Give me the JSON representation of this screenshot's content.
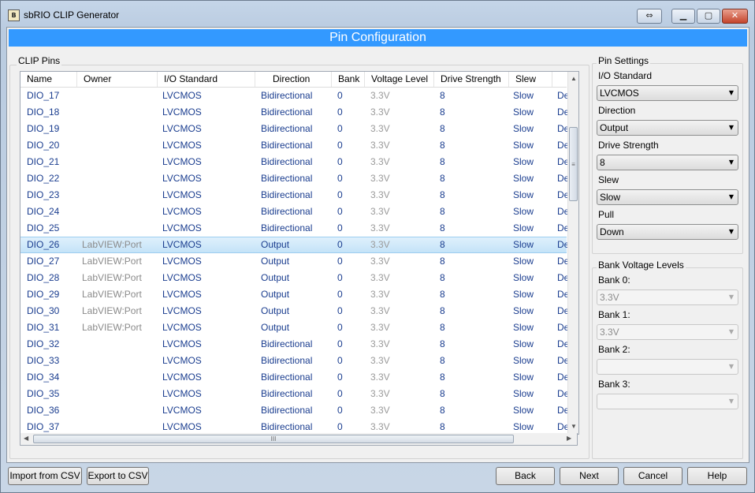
{
  "window": {
    "title": "sbRIO CLIP Generator"
  },
  "banner": {
    "title": "Pin Configuration"
  },
  "clip_pins": {
    "group_label": "CLIP Pins",
    "columns": [
      "Name",
      "Owner",
      "I/O Standard",
      "Direction",
      "Bank",
      "Voltage Level",
      "Drive Strength",
      "Slew",
      ""
    ],
    "rows": [
      {
        "name": "DIO_17",
        "owner": "",
        "io": "LVCMOS",
        "dir": "Bidirectional",
        "bank": "0",
        "volt": "3.3V",
        "drive": "8",
        "slew": "Slow",
        "extra": "De"
      },
      {
        "name": "DIO_18",
        "owner": "",
        "io": "LVCMOS",
        "dir": "Bidirectional",
        "bank": "0",
        "volt": "3.3V",
        "drive": "8",
        "slew": "Slow",
        "extra": "De"
      },
      {
        "name": "DIO_19",
        "owner": "",
        "io": "LVCMOS",
        "dir": "Bidirectional",
        "bank": "0",
        "volt": "3.3V",
        "drive": "8",
        "slew": "Slow",
        "extra": "De"
      },
      {
        "name": "DIO_20",
        "owner": "",
        "io": "LVCMOS",
        "dir": "Bidirectional",
        "bank": "0",
        "volt": "3.3V",
        "drive": "8",
        "slew": "Slow",
        "extra": "De"
      },
      {
        "name": "DIO_21",
        "owner": "",
        "io": "LVCMOS",
        "dir": "Bidirectional",
        "bank": "0",
        "volt": "3.3V",
        "drive": "8",
        "slew": "Slow",
        "extra": "De"
      },
      {
        "name": "DIO_22",
        "owner": "",
        "io": "LVCMOS",
        "dir": "Bidirectional",
        "bank": "0",
        "volt": "3.3V",
        "drive": "8",
        "slew": "Slow",
        "extra": "De"
      },
      {
        "name": "DIO_23",
        "owner": "",
        "io": "LVCMOS",
        "dir": "Bidirectional",
        "bank": "0",
        "volt": "3.3V",
        "drive": "8",
        "slew": "Slow",
        "extra": "De"
      },
      {
        "name": "DIO_24",
        "owner": "",
        "io": "LVCMOS",
        "dir": "Bidirectional",
        "bank": "0",
        "volt": "3.3V",
        "drive": "8",
        "slew": "Slow",
        "extra": "De"
      },
      {
        "name": "DIO_25",
        "owner": "",
        "io": "LVCMOS",
        "dir": "Bidirectional",
        "bank": "0",
        "volt": "3.3V",
        "drive": "8",
        "slew": "Slow",
        "extra": "De"
      },
      {
        "name": "DIO_26",
        "owner": "LabVIEW:Port",
        "io": "LVCMOS",
        "dir": "Output",
        "bank": "0",
        "volt": "3.3V",
        "drive": "8",
        "slew": "Slow",
        "extra": "De",
        "selected": true
      },
      {
        "name": "DIO_27",
        "owner": "LabVIEW:Port",
        "io": "LVCMOS",
        "dir": "Output",
        "bank": "0",
        "volt": "3.3V",
        "drive": "8",
        "slew": "Slow",
        "extra": "De"
      },
      {
        "name": "DIO_28",
        "owner": "LabVIEW:Port",
        "io": "LVCMOS",
        "dir": "Output",
        "bank": "0",
        "volt": "3.3V",
        "drive": "8",
        "slew": "Slow",
        "extra": "De"
      },
      {
        "name": "DIO_29",
        "owner": "LabVIEW:Port",
        "io": "LVCMOS",
        "dir": "Output",
        "bank": "0",
        "volt": "3.3V",
        "drive": "8",
        "slew": "Slow",
        "extra": "De"
      },
      {
        "name": "DIO_30",
        "owner": "LabVIEW:Port",
        "io": "LVCMOS",
        "dir": "Output",
        "bank": "0",
        "volt": "3.3V",
        "drive": "8",
        "slew": "Slow",
        "extra": "De"
      },
      {
        "name": "DIO_31",
        "owner": "LabVIEW:Port",
        "io": "LVCMOS",
        "dir": "Output",
        "bank": "0",
        "volt": "3.3V",
        "drive": "8",
        "slew": "Slow",
        "extra": "De"
      },
      {
        "name": "DIO_32",
        "owner": "",
        "io": "LVCMOS",
        "dir": "Bidirectional",
        "bank": "0",
        "volt": "3.3V",
        "drive": "8",
        "slew": "Slow",
        "extra": "De"
      },
      {
        "name": "DIO_33",
        "owner": "",
        "io": "LVCMOS",
        "dir": "Bidirectional",
        "bank": "0",
        "volt": "3.3V",
        "drive": "8",
        "slew": "Slow",
        "extra": "De"
      },
      {
        "name": "DIO_34",
        "owner": "",
        "io": "LVCMOS",
        "dir": "Bidirectional",
        "bank": "0",
        "volt": "3.3V",
        "drive": "8",
        "slew": "Slow",
        "extra": "De"
      },
      {
        "name": "DIO_35",
        "owner": "",
        "io": "LVCMOS",
        "dir": "Bidirectional",
        "bank": "0",
        "volt": "3.3V",
        "drive": "8",
        "slew": "Slow",
        "extra": "De"
      },
      {
        "name": "DIO_36",
        "owner": "",
        "io": "LVCMOS",
        "dir": "Bidirectional",
        "bank": "0",
        "volt": "3.3V",
        "drive": "8",
        "slew": "Slow",
        "extra": "De"
      },
      {
        "name": "DIO_37",
        "owner": "",
        "io": "LVCMOS",
        "dir": "Bidirectional",
        "bank": "0",
        "volt": "3.3V",
        "drive": "8",
        "slew": "Slow",
        "extra": "De"
      }
    ]
  },
  "pin_settings": {
    "group_label": "Pin Settings",
    "io_standard": {
      "label": "I/O Standard",
      "value": "LVCMOS"
    },
    "direction": {
      "label": "Direction",
      "value": "Output"
    },
    "drive_strength": {
      "label": "Drive Strength",
      "value": "8"
    },
    "slew": {
      "label": "Slew",
      "value": "Slow"
    },
    "pull": {
      "label": "Pull",
      "value": "Down"
    }
  },
  "bank_voltage": {
    "group_label": "Bank Voltage Levels",
    "bank0": {
      "label": "Bank 0:",
      "value": "3.3V"
    },
    "bank1": {
      "label": "Bank 1:",
      "value": "3.3V"
    },
    "bank2": {
      "label": "Bank 2:",
      "value": ""
    },
    "bank3": {
      "label": "Bank 3:",
      "value": ""
    }
  },
  "footer": {
    "import_label": "Import from CSV",
    "export_label": "Export to CSV",
    "back_label": "Back",
    "next_label": "Next",
    "cancel_label": "Cancel",
    "help_label": "Help"
  },
  "icons": {
    "app": "labview-app-icon",
    "resize": "resize-icon",
    "minimize": "minimize-icon",
    "maximize": "maximize-icon",
    "close": "close-icon",
    "dropdown": "chevron-down-icon"
  },
  "colors": {
    "banner": "#3399ff",
    "cell_text": "#1a3d8f",
    "selected_row": "#cde8fa"
  }
}
